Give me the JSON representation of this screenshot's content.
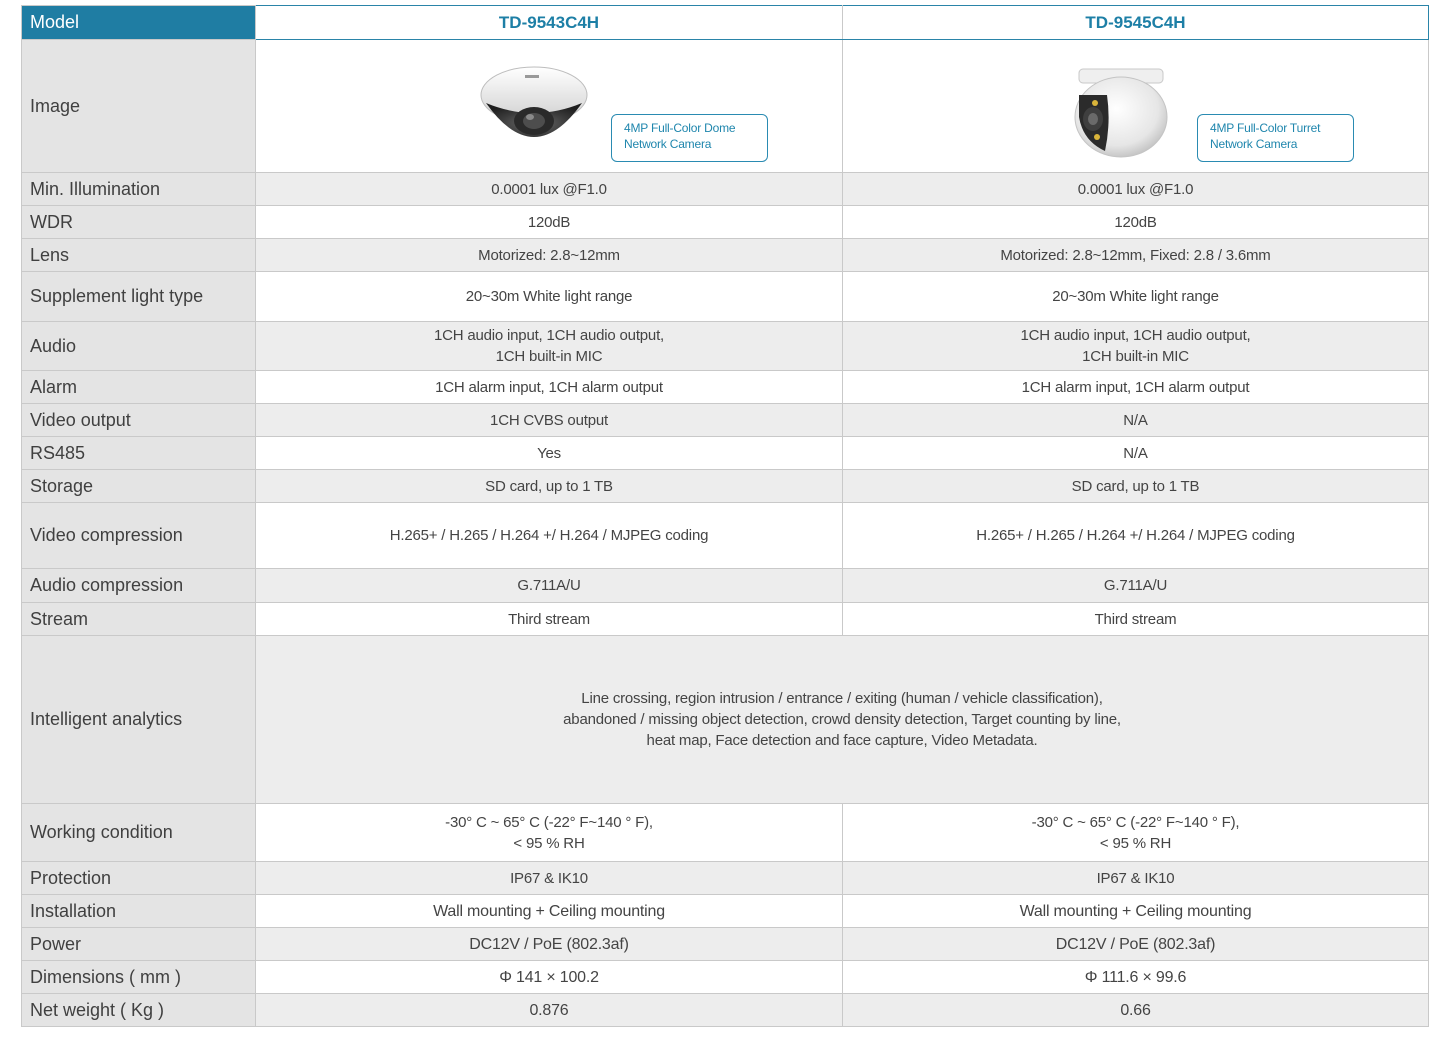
{
  "header": {
    "label": "Model",
    "models": [
      "TD-9543C4H",
      "TD-9545C4H"
    ]
  },
  "image_row": {
    "label": "Image",
    "products": [
      {
        "icon": "dome-camera-icon",
        "caption_line1": "4MP Full-Color Dome",
        "caption_line2": "Network Camera"
      },
      {
        "icon": "turret-camera-icon",
        "caption_line1": "4MP Full-Color Turret",
        "caption_line2": "Network Camera"
      }
    ]
  },
  "rows": [
    {
      "label": "Min. Illumination",
      "v1": "0.0001 lux @F1.0",
      "v2": "0.0001 lux @F1.0"
    },
    {
      "label": "WDR",
      "v1": "120dB",
      "v2": "120dB"
    },
    {
      "label": "Lens",
      "v1": "Motorized: 2.8~12mm",
      "v2": "Motorized: 2.8~12mm, Fixed: 2.8 / 3.6mm"
    },
    {
      "label": "Supplement light type",
      "v1": "20~30m White light range",
      "v2": "20~30m White light range"
    },
    {
      "label": "Audio",
      "v1a": "1CH audio input, 1CH audio output,",
      "v1b": "1CH built-in MIC",
      "v2a": "1CH audio input, 1CH audio output,",
      "v2b": "1CH built-in MIC"
    },
    {
      "label": "Alarm",
      "v1": "1CH alarm input, 1CH alarm output",
      "v2": "1CH alarm input, 1CH alarm output"
    },
    {
      "label": "Video output",
      "v1": "1CH CVBS output",
      "v2": "N/A"
    },
    {
      "label": "RS485",
      "v1": "Yes",
      "v2": "N/A"
    },
    {
      "label": "Storage",
      "v1": "SD card, up to 1 TB",
      "v2": "SD card, up to 1 TB"
    },
    {
      "label": "Video compression",
      "v1": "H.265+ / H.265 / H.264 +/ H.264 / MJPEG coding",
      "v2": "H.265+ / H.265 / H.264 +/ H.264 / MJPEG coding"
    },
    {
      "label": "Audio compression",
      "v1": "G.711A/U",
      "v2": "G.711A/U"
    },
    {
      "label": "Stream",
      "v1": "Third stream",
      "v2": "Third stream"
    },
    {
      "label": "Intelligent analytics",
      "line1": "Line crossing, region intrusion / entrance / exiting (human / vehicle classification),",
      "line2": "abandoned / missing object detection, crowd density detection, Target counting by line,",
      "line3": "heat map, Face detection and face capture, Video Metadata."
    },
    {
      "label": "Working condition",
      "v1a": "-30° C ~ 65° C (-22° F~140 ° F),",
      "v1b": "< 95 % RH",
      "v2a": "-30° C ~ 65° C (-22° F~140 ° F),",
      "v2b": "< 95 % RH"
    },
    {
      "label": "Protection",
      "v1": "IP67 & IK10",
      "v2": "IP67 & IK10"
    },
    {
      "label": "Installation",
      "v1": "Wall mounting + Ceiling mounting",
      "v2": "Wall mounting + Ceiling mounting"
    },
    {
      "label": "Power",
      "v1": "DC12V / PoE (802.3af)",
      "v2": "DC12V / PoE (802.3af)"
    },
    {
      "label": "Dimensions ( mm )",
      "v1": "Φ 141 × 100.2",
      "v2": "Φ 111.6 × 99.6"
    },
    {
      "label": "Net weight ( Kg )",
      "v1": "0.876",
      "v2": "0.66"
    }
  ],
  "colors": {
    "header_blue": "#1f7da3",
    "label_gray": "#e4e4e4",
    "alt_row": "#ededed"
  }
}
